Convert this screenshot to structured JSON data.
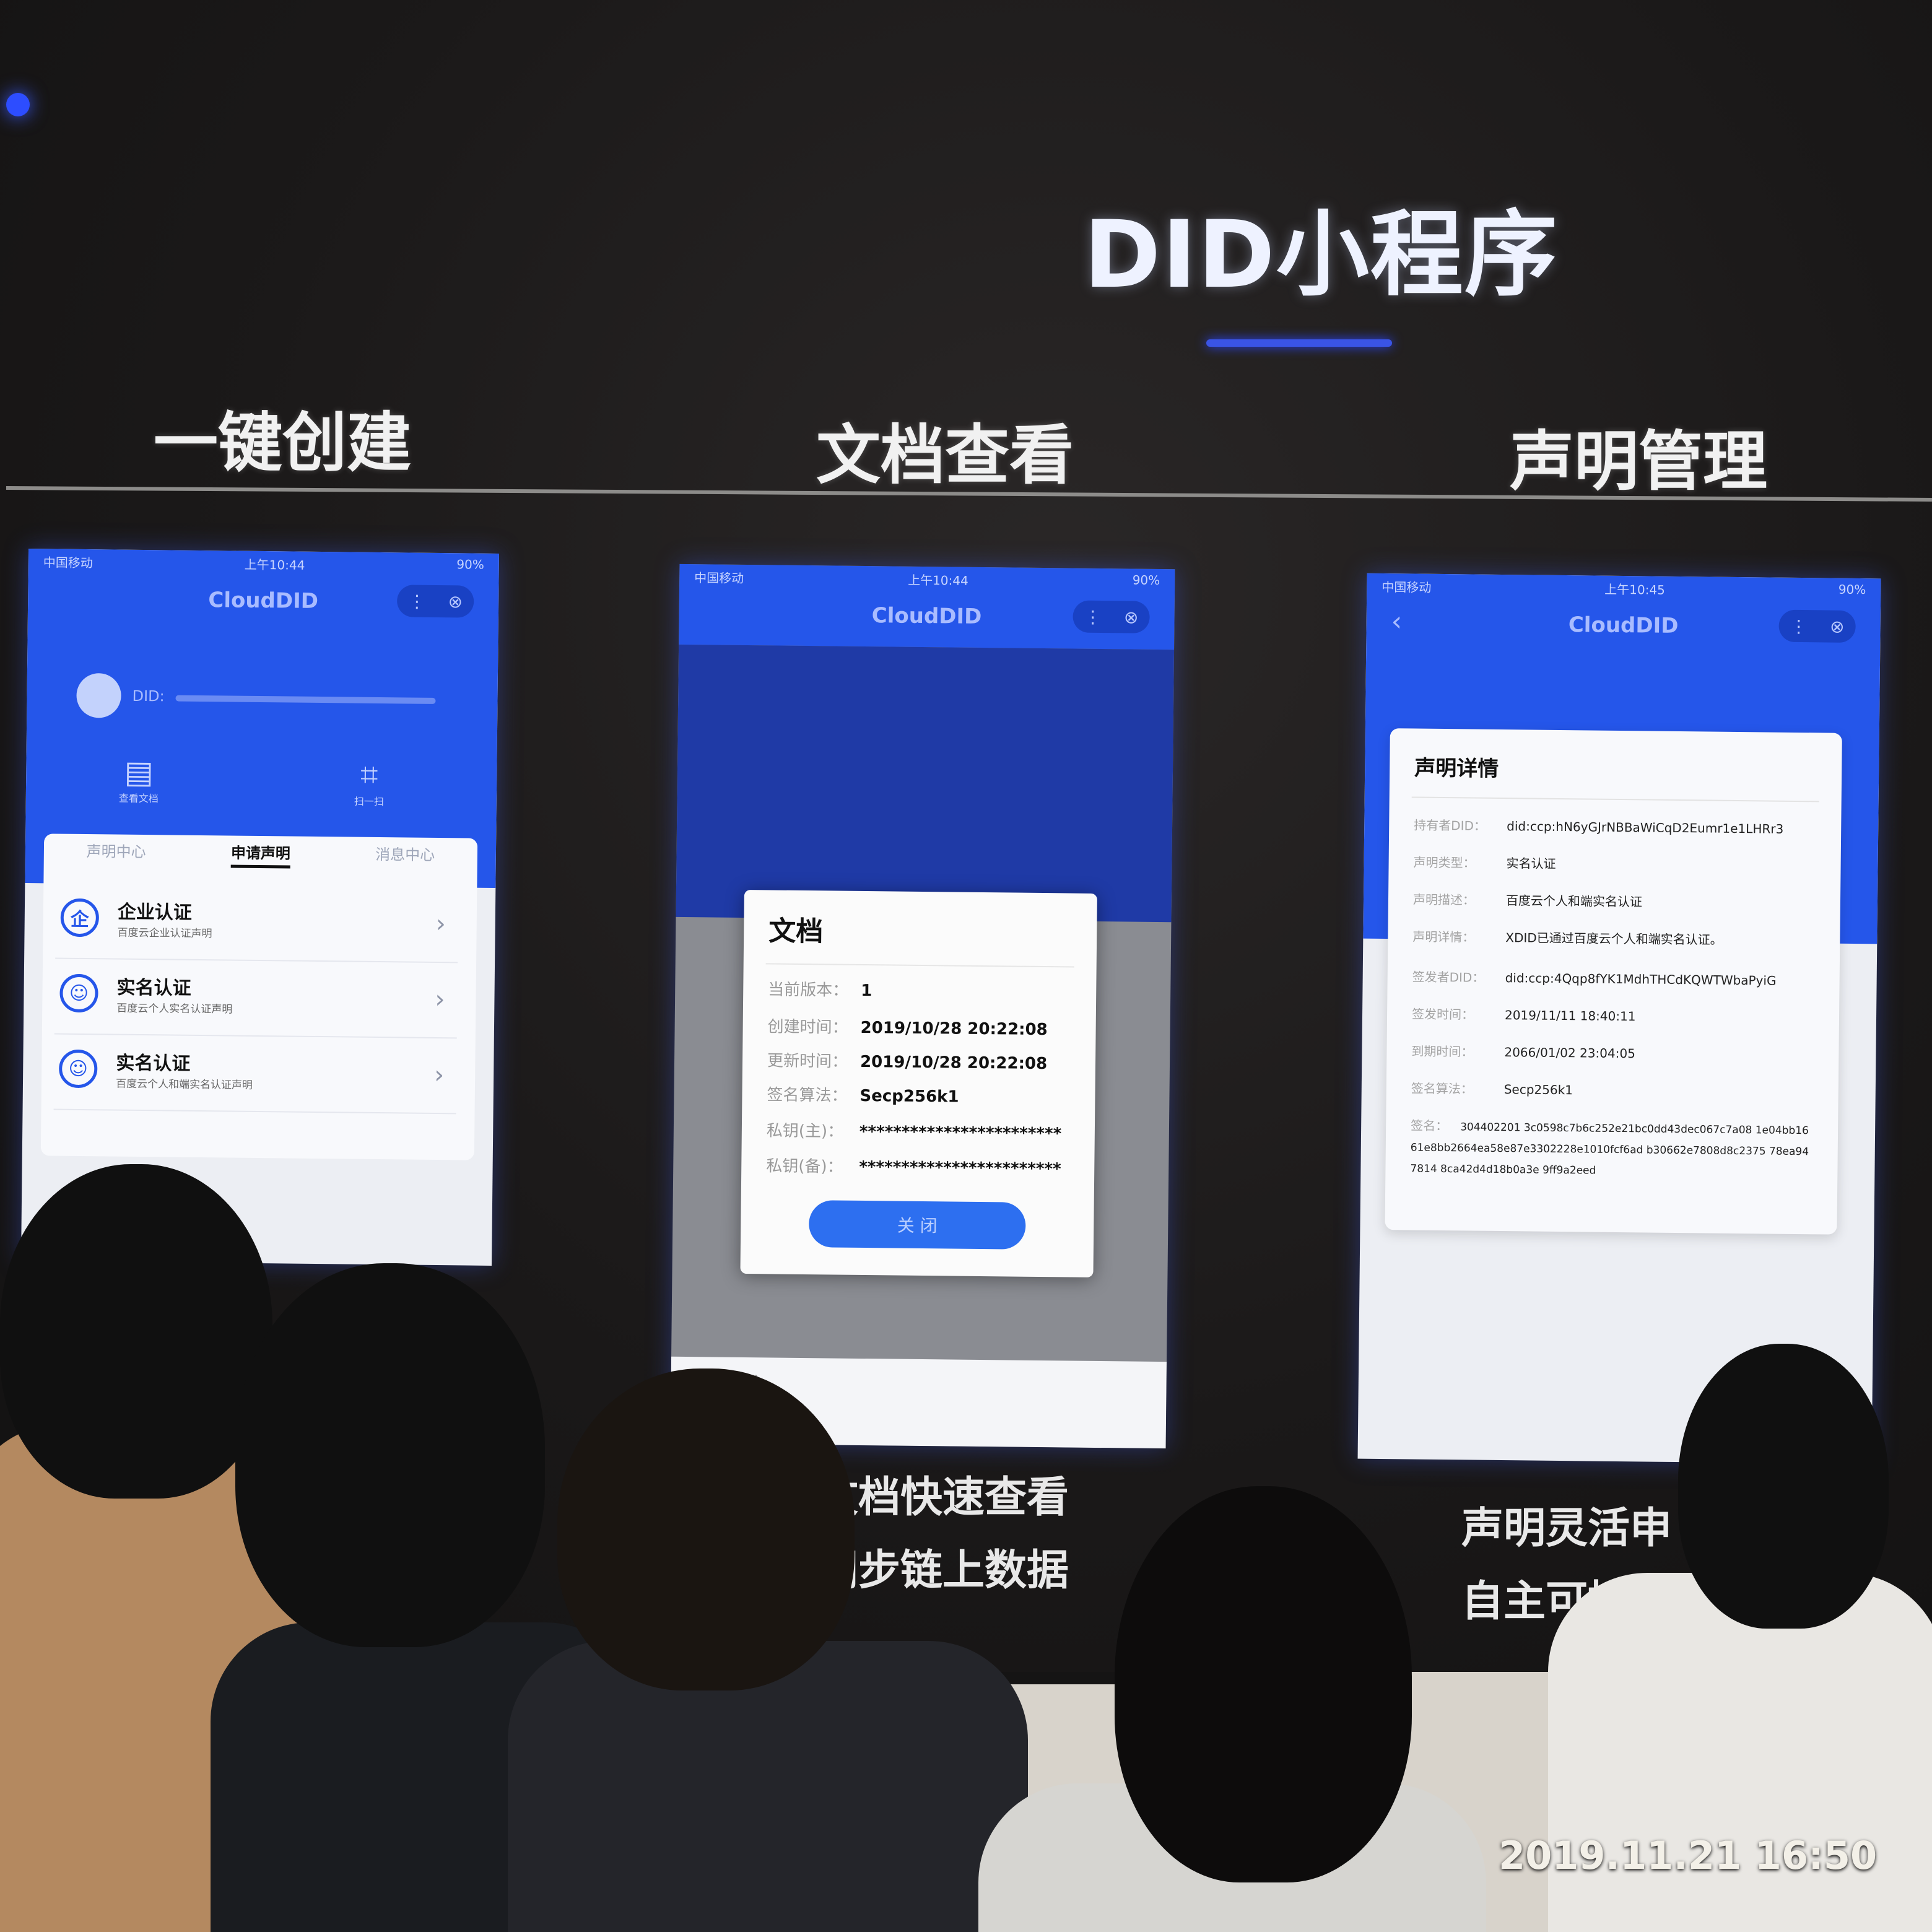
{
  "slide": {
    "headline": "DID小程序",
    "columns": [
      {
        "title": "一键创建"
      },
      {
        "title": "文档查看"
      },
      {
        "title": "声明管理"
      }
    ],
    "captions": {
      "middle": [
        "文档快速查看",
        "同步链上数据"
      ],
      "right": [
        "声明灵活申",
        "自主可控存储"
      ]
    }
  },
  "phone_common": {
    "carrier": "中国移动",
    "battery": "90%",
    "app_name": "CloudDID",
    "more_icon": "more-icon",
    "close_icon": "close-circle-icon"
  },
  "phone1": {
    "time": "上午10:44",
    "did_label": "DID:",
    "actions": [
      "查看文档",
      "扫一扫"
    ],
    "tabs": [
      "声明中心",
      "申请声明",
      "消息中心"
    ],
    "active_tab": "申请声明",
    "items": [
      {
        "title": "企业认证",
        "subtitle": "百度云企业认证声明",
        "icon_text": "企"
      },
      {
        "title": "实名认证",
        "subtitle": "百度云个人实名认证声明",
        "icon_text": ""
      },
      {
        "title": "实名认证",
        "subtitle": "百度云个人和端实名认证声明",
        "icon_text": ""
      }
    ]
  },
  "phone2": {
    "time": "上午10:44",
    "modal": {
      "title": "文档",
      "fields": [
        {
          "key": "当前版本：",
          "value": "1"
        },
        {
          "key": "创建时间：",
          "value": "2019/10/28 20:22:08"
        },
        {
          "key": "更新时间：",
          "value": "2019/10/28 20:22:08"
        },
        {
          "key": "签名算法：",
          "value": "Secp256k1"
        },
        {
          "key": "私钥(主)：",
          "value": "************************"
        },
        {
          "key": "私钥(备)：",
          "value": "************************"
        }
      ],
      "button": "关 闭"
    }
  },
  "phone3": {
    "time": "上午10:45",
    "back_icon": "back-arrow-icon",
    "card_title": "声明详情",
    "fields": [
      {
        "key": "持有者DID：",
        "value": "did:ccp:hN6yGJrNBBaWiCqD2Eumr1e1LHRr3"
      },
      {
        "key": "声明类型：",
        "value": "实名认证"
      },
      {
        "key": "声明描述：",
        "value": "百度云个人和端实名认证"
      },
      {
        "key": "声明详情：",
        "value": "XDID已通过百度云个人和端实名认证。"
      },
      {
        "key": "签发者DID：",
        "value": "did:ccp:4Qqp8fYK1MdhTHCdKQWTWbaPyiG"
      },
      {
        "key": "签发时间：",
        "value": "2019/11/11 18:40:11"
      },
      {
        "key": "到期时间：",
        "value": "2066/01/02 23:04:05"
      },
      {
        "key": "签名算法：",
        "value": "Secp256k1"
      },
      {
        "key": "签名：",
        "value": "304402201 3c0598c7b6c252e21bc0dd43dec067c7a08 1e04bb1661e8bb2664ea58e87e3302228e1010fcf6ad b30662e7808d8c2375 78ea947814 8ca42d4d18b0a3e 9ff9a2eed"
      }
    ]
  },
  "photo": {
    "timestamp": "2019.11.21 16:50"
  }
}
